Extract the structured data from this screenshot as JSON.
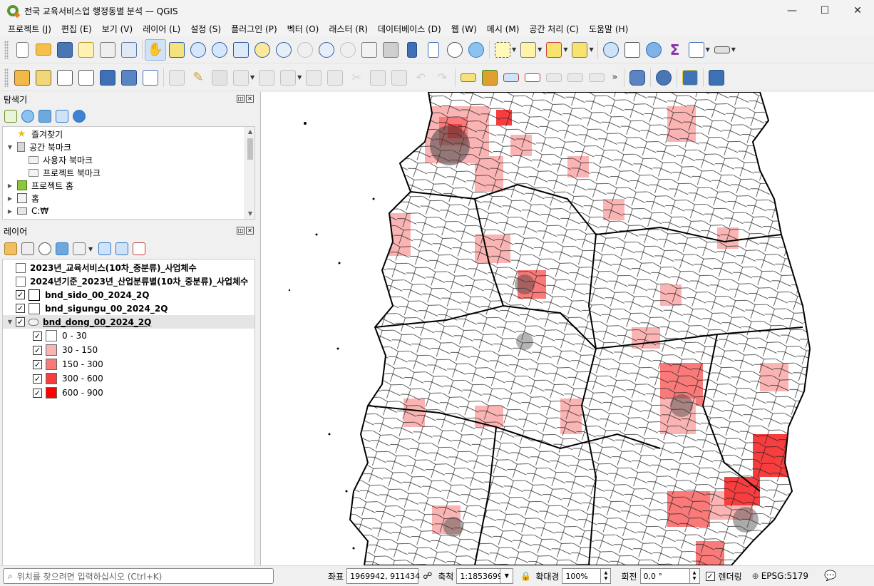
{
  "window": {
    "title": "전국 교육서비스업 행정동별 분석 — QGIS",
    "controls": {
      "minimize": "—",
      "maximize": "☐",
      "close": "✕"
    }
  },
  "menu": [
    "프로젝트 (J)",
    "편집 (E)",
    "보기 (V)",
    "레이어 (L)",
    "설정 (S)",
    "플러그인 (P)",
    "벡터 (O)",
    "래스터 (R)",
    "데이터베이스 (D)",
    "웹 (W)",
    "메시 (M)",
    "공간 처리 (C)",
    "도움말 (H)"
  ],
  "colors": {
    "accent": "#589632",
    "class_0": "#ffffff",
    "class_1": "#fbb4b4",
    "class_2": "#fa7979",
    "class_3": "#f73d3d",
    "class_4": "#ff0000"
  },
  "browser": {
    "title": "탐색기",
    "items": [
      {
        "label": "즐겨찾기",
        "icon": "star-icon",
        "indent": 0,
        "arrow": ""
      },
      {
        "label": "공간 북마크",
        "icon": "bookmark-icon",
        "indent": 0,
        "arrow": "▼"
      },
      {
        "label": "사용자 북마크",
        "icon": "folder-icon",
        "indent": 1,
        "arrow": ""
      },
      {
        "label": "프로젝트 북마크",
        "icon": "folder-icon",
        "indent": 1,
        "arrow": ""
      },
      {
        "label": "프로젝트 홈",
        "icon": "project-home-icon",
        "indent": 0,
        "arrow": "▶"
      },
      {
        "label": "홈",
        "icon": "home-icon",
        "indent": 0,
        "arrow": "▶"
      },
      {
        "label": "C:₩",
        "icon": "drive-icon",
        "indent": 0,
        "arrow": "▶"
      }
    ]
  },
  "layers": {
    "title": "레이어",
    "items": [
      {
        "label": "2023년_교육서비스(10차_중분류)_사업체수",
        "type": "table"
      },
      {
        "label": "2024년기준_2023년_산업분류별(10차_중분류)_사업체수",
        "type": "table"
      },
      {
        "label": "bnd_sido_00_2024_2Q",
        "type": "polygon",
        "checked": "✓"
      },
      {
        "label": "bnd_sigungu_00_2024_2Q",
        "type": "polygon",
        "checked": "✓"
      },
      {
        "label": "bnd_dong_00_2024_2Q",
        "type": "graduated",
        "checked": "✓"
      }
    ],
    "classes": [
      {
        "label": "0 - 30",
        "checked": "✓"
      },
      {
        "label": "30 - 150",
        "checked": "✓"
      },
      {
        "label": "150 - 300",
        "checked": "✓"
      },
      {
        "label": "300 - 600",
        "checked": "✓"
      },
      {
        "label": "600 - 900",
        "checked": "✓"
      }
    ]
  },
  "status": {
    "search_placeholder": "위치를 찾으려면 입력하십시오 (Ctrl+K)",
    "coord_label": "좌표",
    "coord_value": "1969942, 911434",
    "scale_label": "축척",
    "scale_value": "1:1853699",
    "magnifier_label": "확대경",
    "magnifier_value": "100%",
    "rotation_label": "회전",
    "rotation_value": "0,0 °",
    "render_label": "렌더링",
    "render_checked": "✓",
    "crs": "EPSG:5179"
  }
}
